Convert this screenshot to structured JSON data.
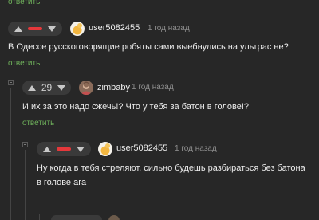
{
  "top": {
    "reply_label": "ответить"
  },
  "comment1": {
    "username": "user5082455",
    "time": "1 год назад",
    "text": "В Одессе русскоговорящие робяты сами выебнулись на ультрас не?",
    "reply_label": "ответить"
  },
  "comment2": {
    "rating": "29",
    "username": "zimbaby",
    "time": "1 год назад",
    "text": "И их за это надо сжечь!? Что у тебя за батон в голове!?",
    "reply_label": "ответить"
  },
  "comment3": {
    "username": "user5082455",
    "time": "1 год назад",
    "text_line1": "Ну когда в тебя стреляют, сильно будешь разбираться без батона",
    "text_line2": "в голове ага"
  },
  "colors": {
    "background": "#272727",
    "reply_link": "#6fb15b",
    "downvote_bar": "#e5383b",
    "vote_pill": "#3a3a3a"
  },
  "icons": {
    "upvote": "triangle-up-icon",
    "downvote": "triangle-down-icon",
    "collapse": "collapse-thread-icon"
  }
}
